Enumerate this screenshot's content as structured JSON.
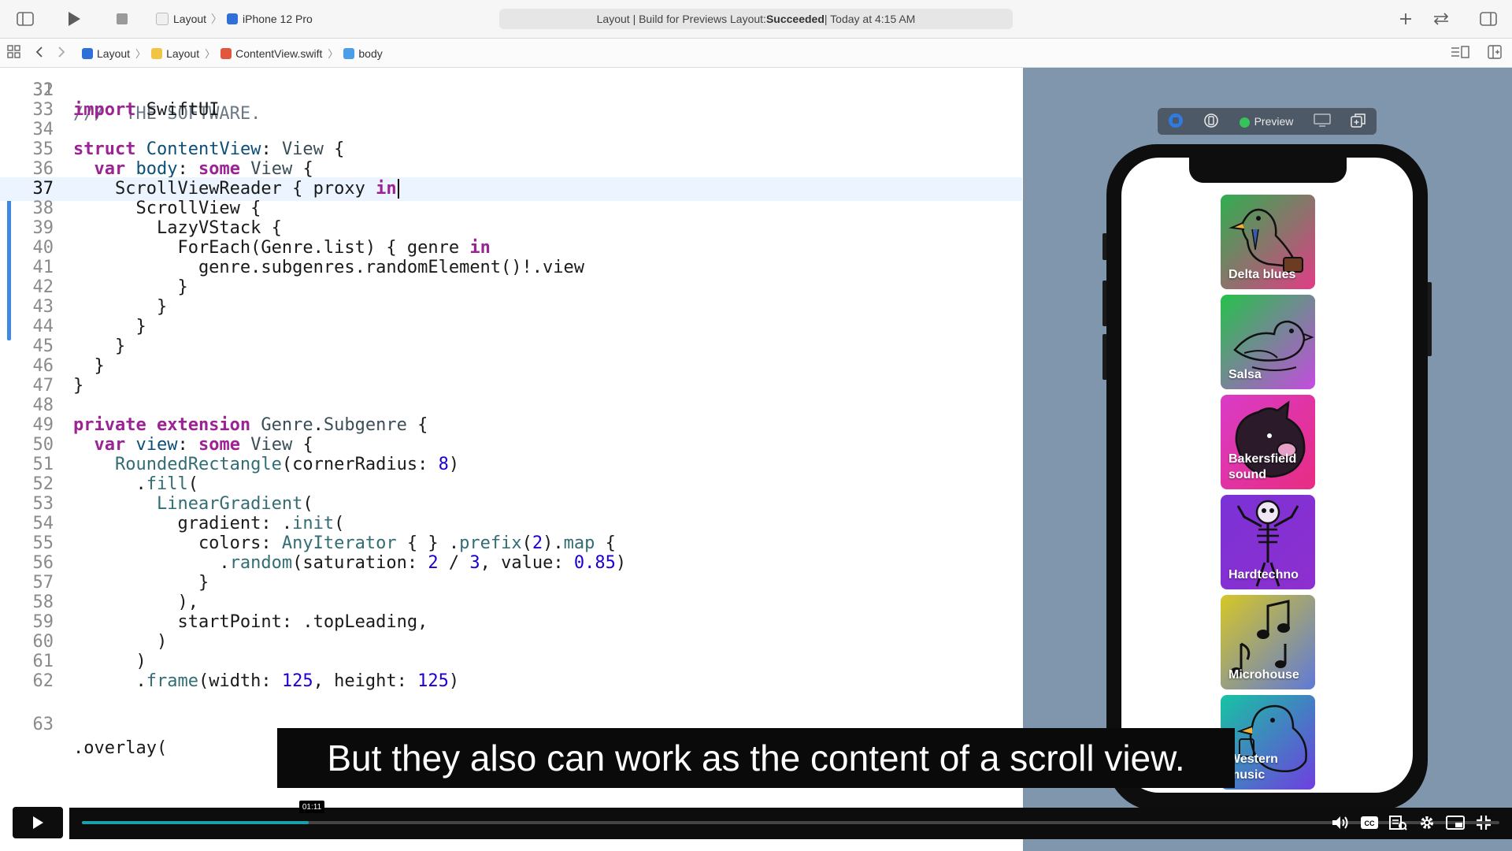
{
  "toolbar": {
    "scheme_project": "Layout",
    "scheme_device": "iPhone 12 Pro",
    "status_prefix": "Layout | Build for Previews Layout: ",
    "status_result": "Succeeded",
    "status_suffix": " | Today at 4:15 AM"
  },
  "jumpbar": {
    "crumbs": [
      "Layout",
      "Layout",
      "ContentView.swift",
      "body"
    ]
  },
  "editor": {
    "current_line": 37,
    "partial_top_text": "///  THE SOFTWARE.",
    "partial_top_number": "31",
    "partial_bottom_number": "63",
    "partial_bottom_text": ".overlay("
  },
  "preview": {
    "label": "Preview",
    "tiles": [
      {
        "label": "Delta blues",
        "colors": [
          "#2fae4f",
          "#e23c86"
        ]
      },
      {
        "label": "Salsa",
        "colors": [
          "#25c24a",
          "#c54be0"
        ]
      },
      {
        "label": "Bakersfield sound",
        "colors": [
          "#d93cc7",
          "#e82c82"
        ]
      },
      {
        "label": "Hardtechno",
        "colors": [
          "#7a32d6",
          "#8f2fcf"
        ]
      },
      {
        "label": "Microhouse",
        "colors": [
          "#d6c726",
          "#5f79d8"
        ]
      },
      {
        "label": "Western music",
        "colors": [
          "#17c3a3",
          "#6f3ee0"
        ]
      }
    ]
  },
  "video": {
    "caption": "But they also can work as the content of a scroll view.",
    "timestamp": "01:11",
    "progress_fraction": 0.16
  }
}
